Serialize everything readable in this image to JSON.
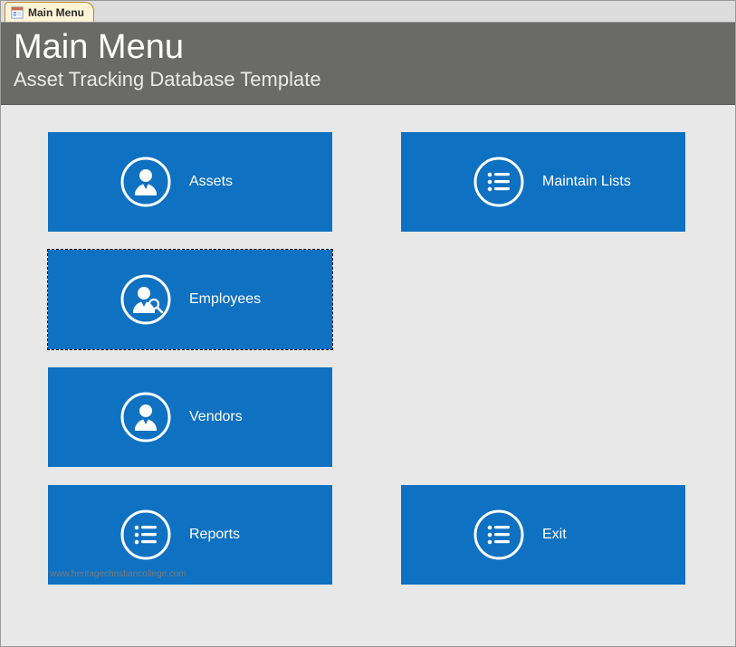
{
  "tab": {
    "title": "Main Menu"
  },
  "header": {
    "title": "Main Menu",
    "subtitle": "Asset Tracking Database Template"
  },
  "tiles": {
    "assets": {
      "label": "Assets",
      "icon": "user-circle-icon"
    },
    "employees": {
      "label": "Employees",
      "icon": "user-search-circle-icon"
    },
    "vendors": {
      "label": "Vendors",
      "icon": "user-tie-circle-icon"
    },
    "reports": {
      "label": "Reports",
      "icon": "list-circle-icon"
    },
    "maintain": {
      "label": "Maintain Lists",
      "icon": "list-circle-icon"
    },
    "exit": {
      "label": "Exit",
      "icon": "list-circle-icon"
    }
  },
  "watermark": "www.heritagechristiancollege.com"
}
